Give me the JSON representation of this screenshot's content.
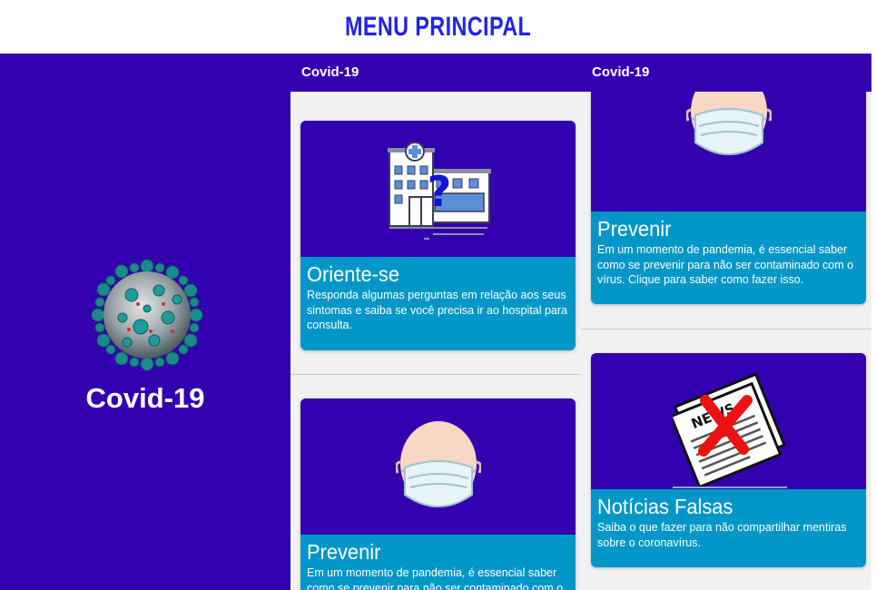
{
  "header": {
    "title": "MENU PRINCIPAL"
  },
  "splash": {
    "app_name": "Covid-19",
    "logo_icon": "coronavirus-icon"
  },
  "screen1": {
    "appbar_title": "Covid-19",
    "cards": [
      {
        "title": "Oriente-se",
        "description": "Responda algumas perguntas em relação aos seus sintomas e saiba se você precisa ir ao hospital para consulta.",
        "icon": "hospital-question-icon"
      },
      {
        "title": "Prevenir",
        "description": "Em um momento de pandemia, é essencial saber como se prevenir para não ser contaminado com o",
        "icon": "face-mask-icon"
      }
    ]
  },
  "screen2": {
    "appbar_title": "Covid-19",
    "cards": [
      {
        "title": "Prevenir",
        "description": "Em um momento de pandemia, é essencial saber como se prevenir para não ser contaminado com o vírus. Clique para saber como fazer isso.",
        "icon": "face-mask-icon"
      },
      {
        "title": "Notícias Falsas",
        "description": "Saiba o que fazer para não compartilhar mentiras sobre o coronavírus.",
        "icon": "fake-news-icon",
        "news_word": "NEWS"
      }
    ]
  },
  "colors": {
    "primary": "#3300b0",
    "card_body": "#0097c8",
    "title": "#2222ee",
    "background": "#f1f1f1"
  }
}
